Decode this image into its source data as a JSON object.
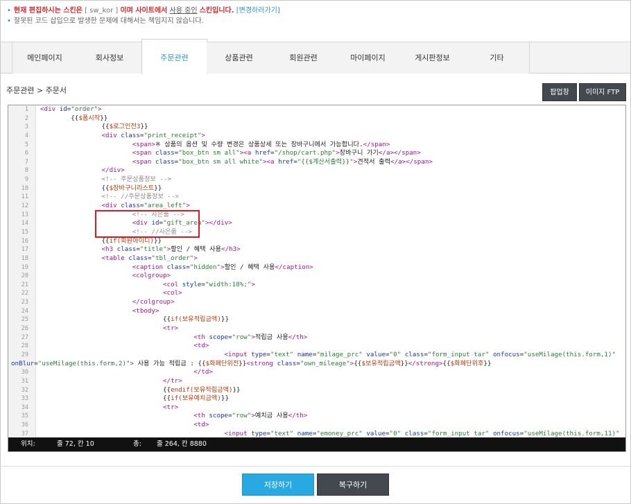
{
  "notice": {
    "line1_prefix": "현재 편집하시는 스킨은",
    "skin_code": "[ sw_kor ]",
    "line1_mid": "이며 사이트에서",
    "in_use": "사용 중인",
    "line1_suffix": "스킨입니다.",
    "change_link": "[변경하러가기]",
    "line2": "잘못된 코드 삽입으로 발생한 문제에 대해서는 책임지지 않습니다."
  },
  "tabs": [
    {
      "label": "메인페이지"
    },
    {
      "label": "회사정보"
    },
    {
      "label": "주문관련"
    },
    {
      "label": "상품관련"
    },
    {
      "label": "회원관련"
    },
    {
      "label": "마이페이지"
    },
    {
      "label": "게시판정보"
    },
    {
      "label": "기타"
    }
  ],
  "breadcrumb": "주문관련 > 주문서",
  "buttons": {
    "popup": "팝업창",
    "image_ftp": "이미지 FTP",
    "save": "저장하기",
    "restore": "복구하기"
  },
  "status": {
    "pos_label": "위치:",
    "pos_value": "줄 72, 칸 10",
    "total_label": "총:",
    "total_value": "줄 264, 칸 8880"
  },
  "colors": {
    "accent": "#2a9ad8",
    "highlight_border": "#e0181c",
    "dark_button": "#44484f",
    "save_button": "#29a9e1"
  }
}
